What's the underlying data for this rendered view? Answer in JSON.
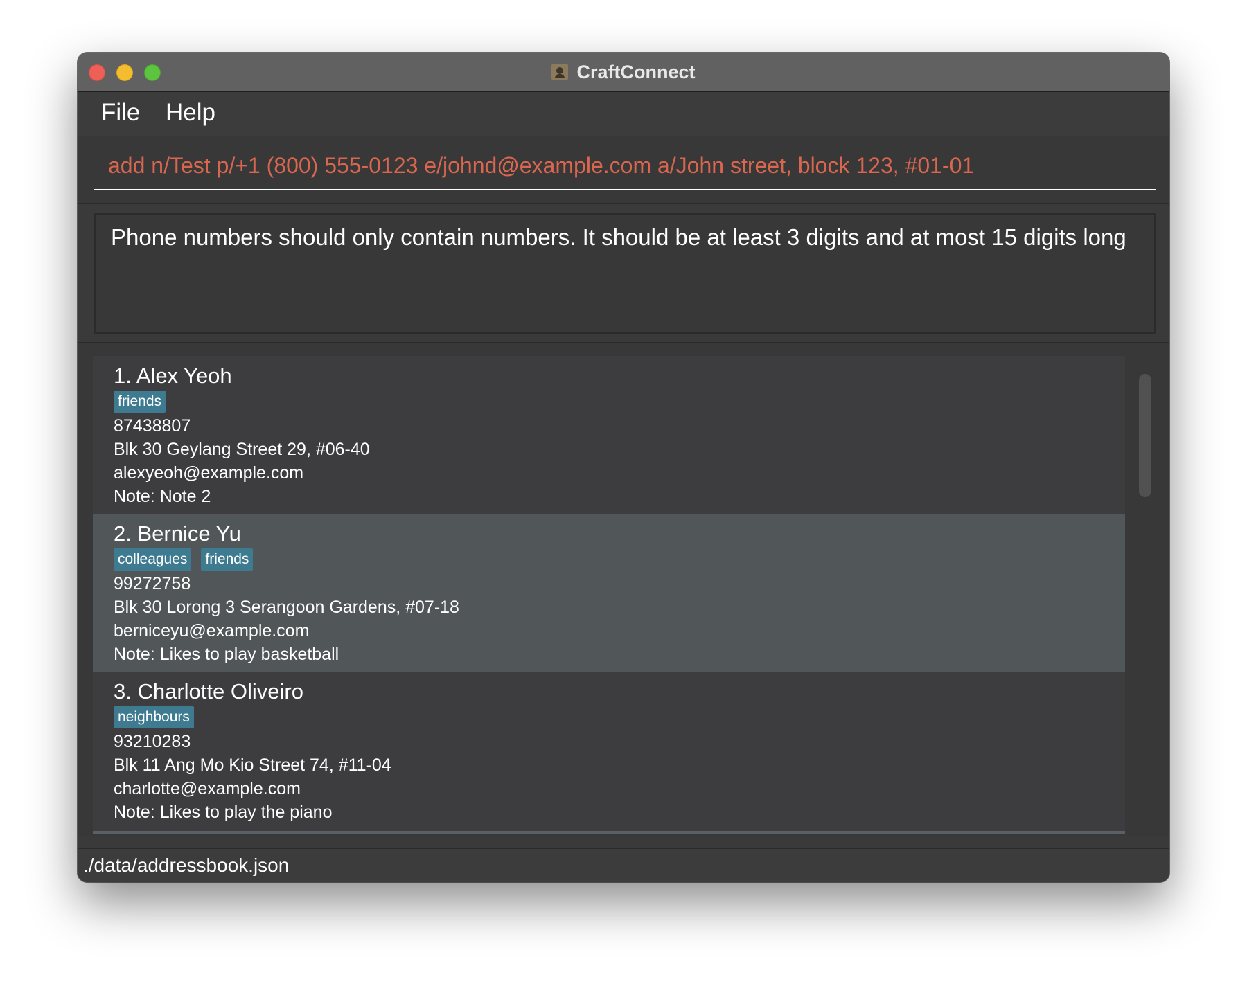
{
  "window": {
    "title": "CraftConnect",
    "icon": "address-book-icon"
  },
  "menu": {
    "file_label": "File",
    "help_label": "Help"
  },
  "command": {
    "value": "add n/Test p/+1 (800) 555-0123 e/johnd@example.com a/John street, block 123, #01-01",
    "error_color": "#d9664f"
  },
  "result": {
    "message": "Phone numbers should only contain numbers. It should be at least 3 digits and at most 15 digits long"
  },
  "persons": [
    {
      "name": "1. Alex Yeoh",
      "tags": [
        "friends"
      ],
      "phone": "87438807",
      "address": "Blk 30 Geylang Street 29, #06-40",
      "email": "alexyeoh@example.com",
      "note": "Note: Note 2"
    },
    {
      "name": "2. Bernice Yu",
      "tags": [
        "colleagues",
        "friends"
      ],
      "phone": "99272758",
      "address": "Blk 30 Lorong 3 Serangoon Gardens, #07-18",
      "email": "berniceyu@example.com",
      "note": "Note: Likes to play basketball"
    },
    {
      "name": "3. Charlotte Oliveiro",
      "tags": [
        "neighbours"
      ],
      "phone": "93210283",
      "address": "Blk 11 Ang Mo Kio Street 74, #11-04",
      "email": "charlotte@example.com",
      "note": "Note: Likes to play the piano"
    }
  ],
  "status": {
    "file_path": "./data/addressbook.json"
  },
  "colors": {
    "tag_background": "#3e7b91",
    "selected_card": "#515659"
  }
}
